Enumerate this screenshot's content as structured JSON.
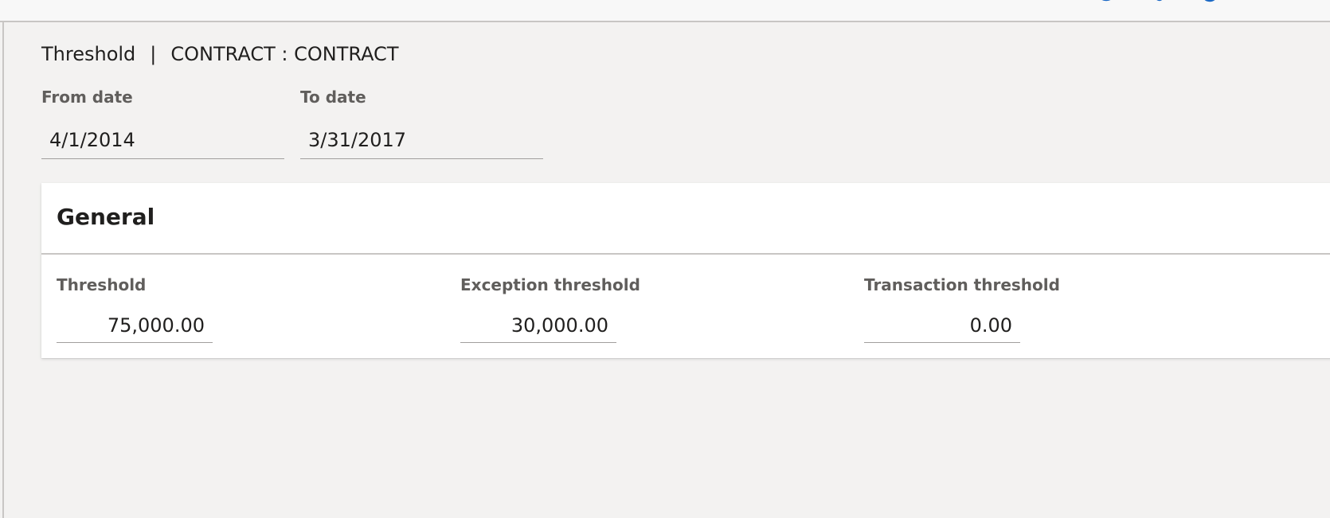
{
  "header": {
    "title": "Threshold",
    "separator": "|",
    "context": "CONTRACT : CONTRACT"
  },
  "dates": {
    "from_label": "From date",
    "from_value": "4/1/2014",
    "to_label": "To date",
    "to_value": "3/31/2017"
  },
  "general": {
    "title": "General",
    "fields": [
      {
        "label": "Threshold",
        "value": "75,000.00"
      },
      {
        "label": "Exception threshold",
        "value": "30,000.00"
      },
      {
        "label": "Transaction threshold",
        "value": "0.00"
      }
    ]
  },
  "topbar": {
    "icons": [
      "chat-icon",
      "settings-icon",
      "help-icon"
    ],
    "accent": "#1c69c5"
  }
}
